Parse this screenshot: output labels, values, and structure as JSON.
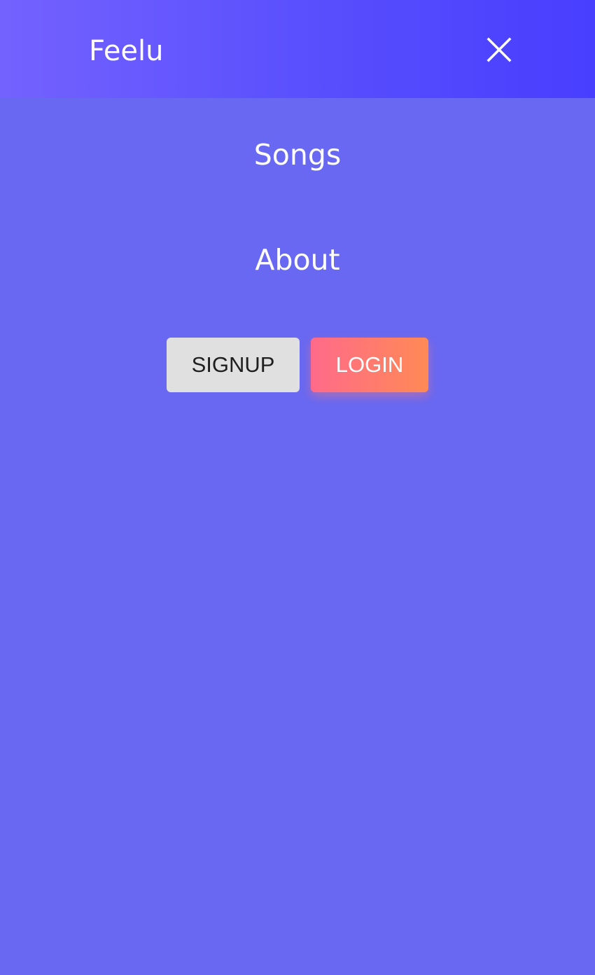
{
  "header": {
    "brand": "Feelu",
    "close_icon": "close-icon"
  },
  "menu": {
    "items": [
      {
        "label": "Songs"
      },
      {
        "label": "About"
      }
    ]
  },
  "auth": {
    "signup_label": "SIGNUP",
    "login_label": "LOGIN"
  },
  "colors": {
    "background": "#6868f2",
    "header_gradient_start": "#7462fe",
    "header_gradient_end": "#483efe",
    "signup_bg": "#e0e0e0",
    "login_gradient_start": "#ff6a8a",
    "login_gradient_end": "#ff8a55"
  }
}
